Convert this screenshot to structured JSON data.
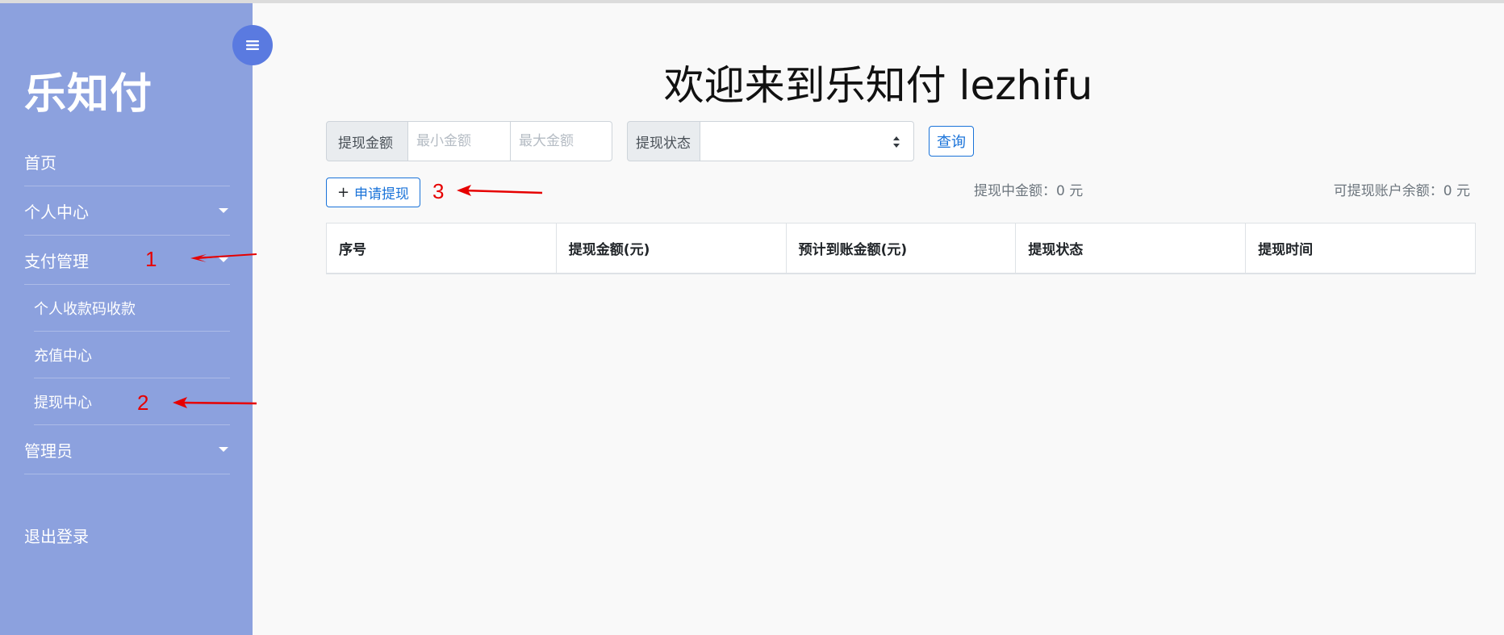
{
  "brand": "乐知付",
  "sidebar": {
    "items": [
      {
        "label": "首页",
        "has_caret": false
      },
      {
        "label": "个人中心",
        "has_caret": true
      },
      {
        "label": "支付管理",
        "has_caret": true
      }
    ],
    "sub_items": [
      {
        "label": "个人收款码收款"
      },
      {
        "label": "充值中心"
      },
      {
        "label": "提现中心"
      }
    ],
    "admin": {
      "label": "管理员",
      "has_caret": true
    },
    "logout": "退出登录"
  },
  "main": {
    "title": "欢迎来到乐知付 lezhifu",
    "filters": {
      "amount_label": "提现金额",
      "min_placeholder": "最小金额",
      "max_placeholder": "最大金额",
      "status_label": "提现状态",
      "status_value": "",
      "query_button": "查询"
    },
    "apply_button": {
      "icon": "+",
      "label": "申请提现"
    },
    "stats": {
      "withdrawing": "提现中金额：0 元",
      "available": "可提现账户余额：0 元"
    },
    "table": {
      "columns": [
        "序号",
        "提现金额(元)",
        "预计到账金额(元)",
        "提现状态",
        "提现时间"
      ],
      "rows": []
    }
  },
  "annotations": [
    "1",
    "2",
    "3"
  ],
  "colors": {
    "sidebar_bg": "#8ca1de",
    "toggle_bg": "#5a7ae0",
    "accent": "#1a73d9",
    "annotation": "#e60000"
  }
}
